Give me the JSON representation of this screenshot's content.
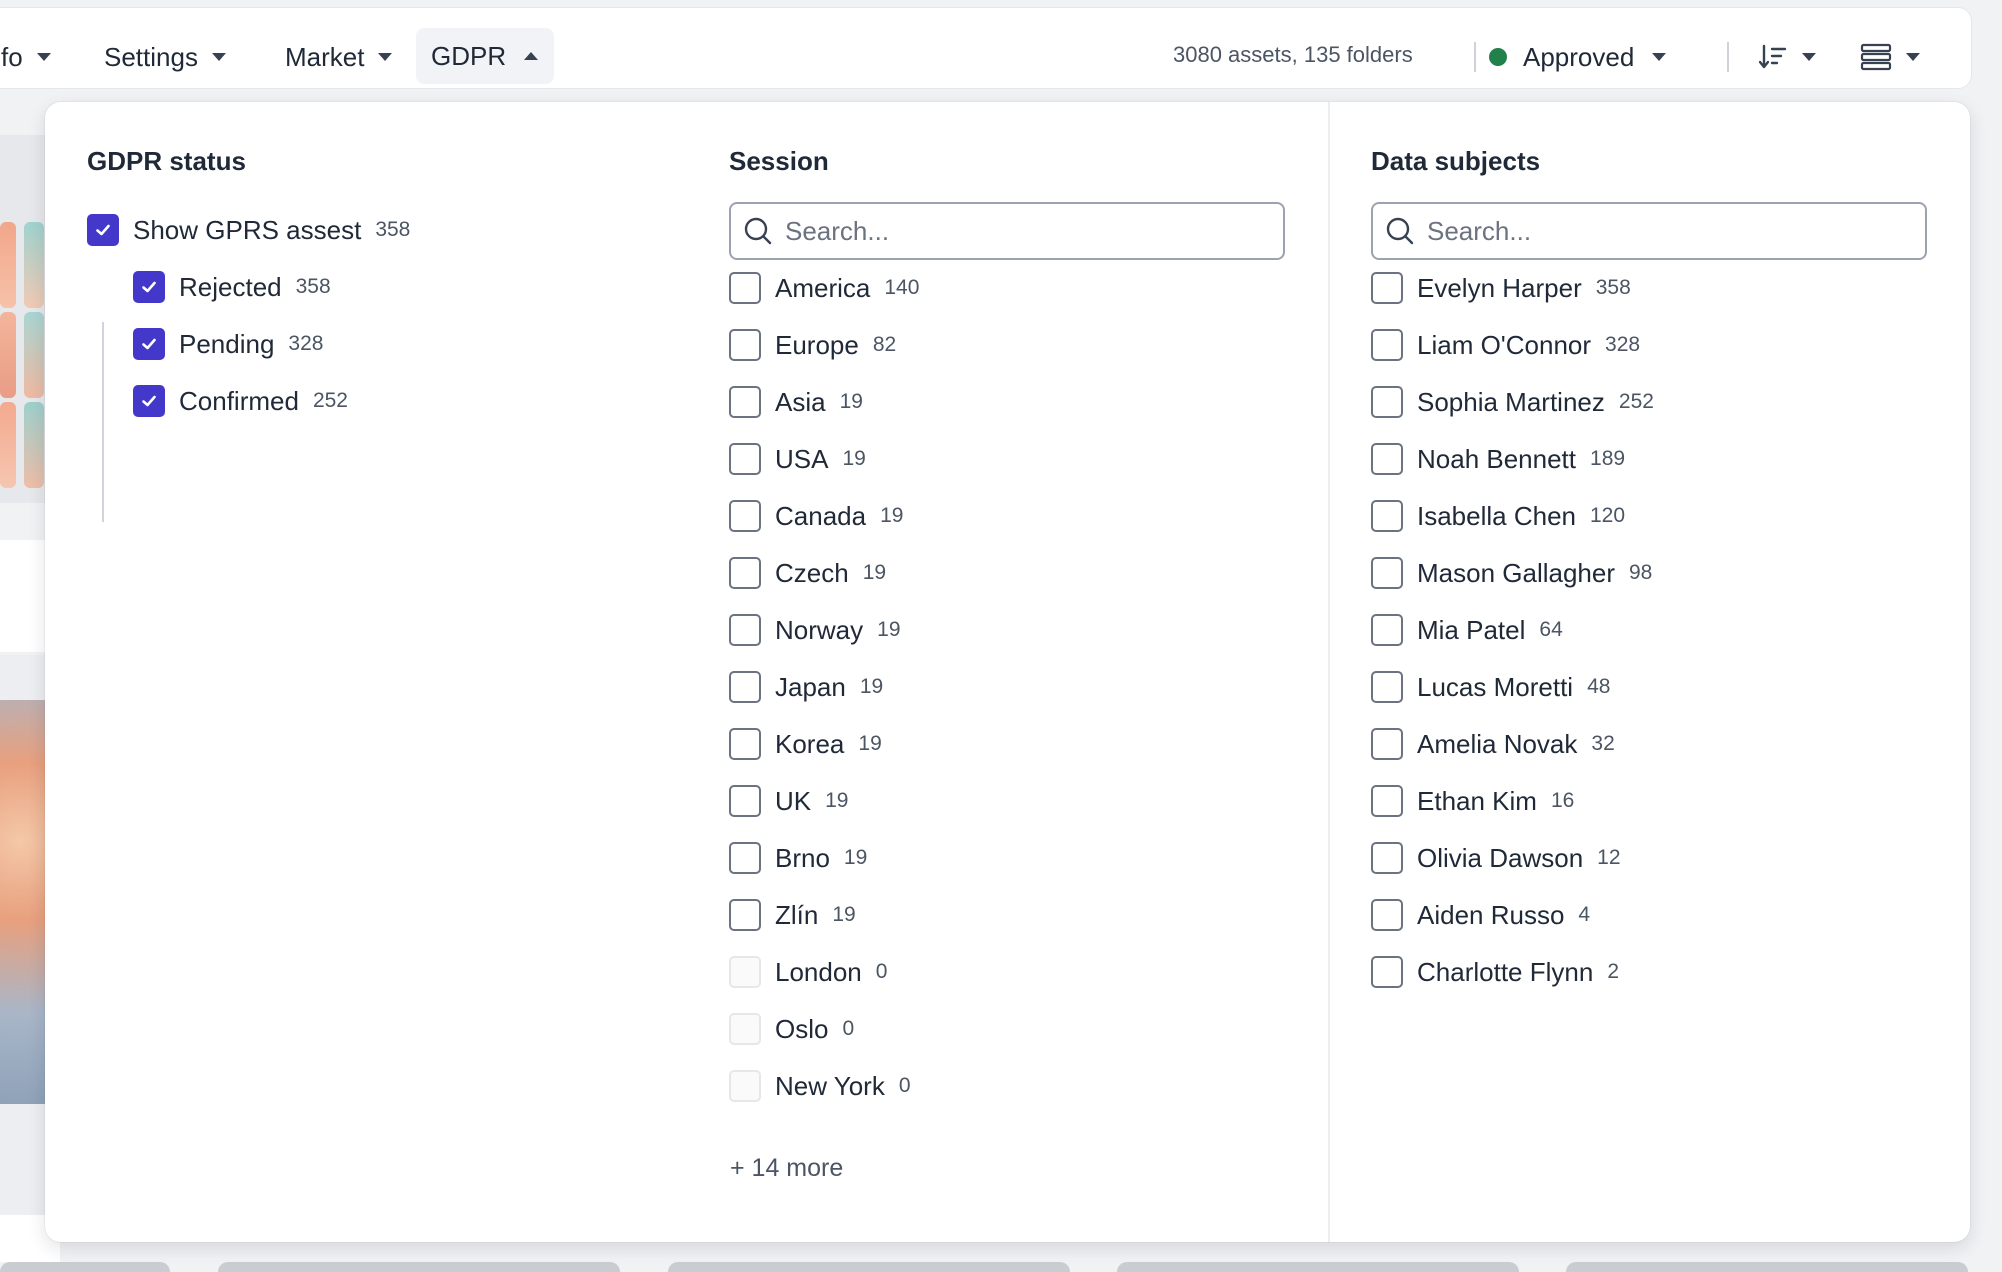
{
  "toolbar": {
    "items": [
      {
        "label": "fo"
      },
      {
        "label": "Settings"
      },
      {
        "label": "Market"
      }
    ],
    "active_item": {
      "label": "GDPR"
    },
    "asset_count": "3080 assets, 135 folders",
    "status": {
      "label": "Approved",
      "color": "#22804b"
    },
    "sort_icon": "sort-descending-icon",
    "view_icon": "list-view-icon"
  },
  "gdpr_panel": {
    "gdpr_status": {
      "title": "GDPR status",
      "parent": {
        "label": "Show GPRS assest",
        "count": "358",
        "checked": true
      },
      "children": [
        {
          "label": "Rejected",
          "count": "358",
          "checked": true
        },
        {
          "label": "Pending",
          "count": "328",
          "checked": true
        },
        {
          "label": "Confirmed",
          "count": "252",
          "checked": true
        }
      ]
    },
    "session": {
      "title": "Session",
      "search_placeholder": "Search...",
      "options": [
        {
          "label": "America",
          "count": "140"
        },
        {
          "label": "Europe",
          "count": "82"
        },
        {
          "label": "Asia",
          "count": "19"
        },
        {
          "label": "USA",
          "count": "19"
        },
        {
          "label": "Canada",
          "count": "19"
        },
        {
          "label": "Czech",
          "count": "19"
        },
        {
          "label": "Norway",
          "count": "19"
        },
        {
          "label": "Japan",
          "count": "19"
        },
        {
          "label": "Korea",
          "count": "19"
        },
        {
          "label": "UK",
          "count": "19"
        },
        {
          "label": "Brno",
          "count": "19"
        },
        {
          "label": "Zlín",
          "count": "19"
        },
        {
          "label": "London",
          "count": "0",
          "disabled": true
        },
        {
          "label": "Oslo",
          "count": "0",
          "disabled": true
        },
        {
          "label": "New York",
          "count": "0",
          "disabled": true
        }
      ],
      "more_label": "+ 14 more"
    },
    "data_subjects": {
      "title": "Data subjects",
      "search_placeholder": "Search...",
      "options": [
        {
          "label": "Evelyn Harper",
          "count": "358"
        },
        {
          "label": "Liam O'Connor",
          "count": "328"
        },
        {
          "label": "Sophia Martinez",
          "count": "252"
        },
        {
          "label": "Noah Bennett",
          "count": "189"
        },
        {
          "label": "Isabella Chen",
          "count": "120"
        },
        {
          "label": "Mason Gallagher",
          "count": "98"
        },
        {
          "label": "Mia Patel",
          "count": "64"
        },
        {
          "label": "Lucas Moretti",
          "count": "48"
        },
        {
          "label": "Amelia Novak",
          "count": "32"
        },
        {
          "label": "Ethan Kim",
          "count": "16"
        },
        {
          "label": "Olivia Dawson",
          "count": "12"
        },
        {
          "label": "Aiden Russo",
          "count": "4"
        },
        {
          "label": "Charlotte Flynn",
          "count": "2"
        }
      ]
    }
  }
}
